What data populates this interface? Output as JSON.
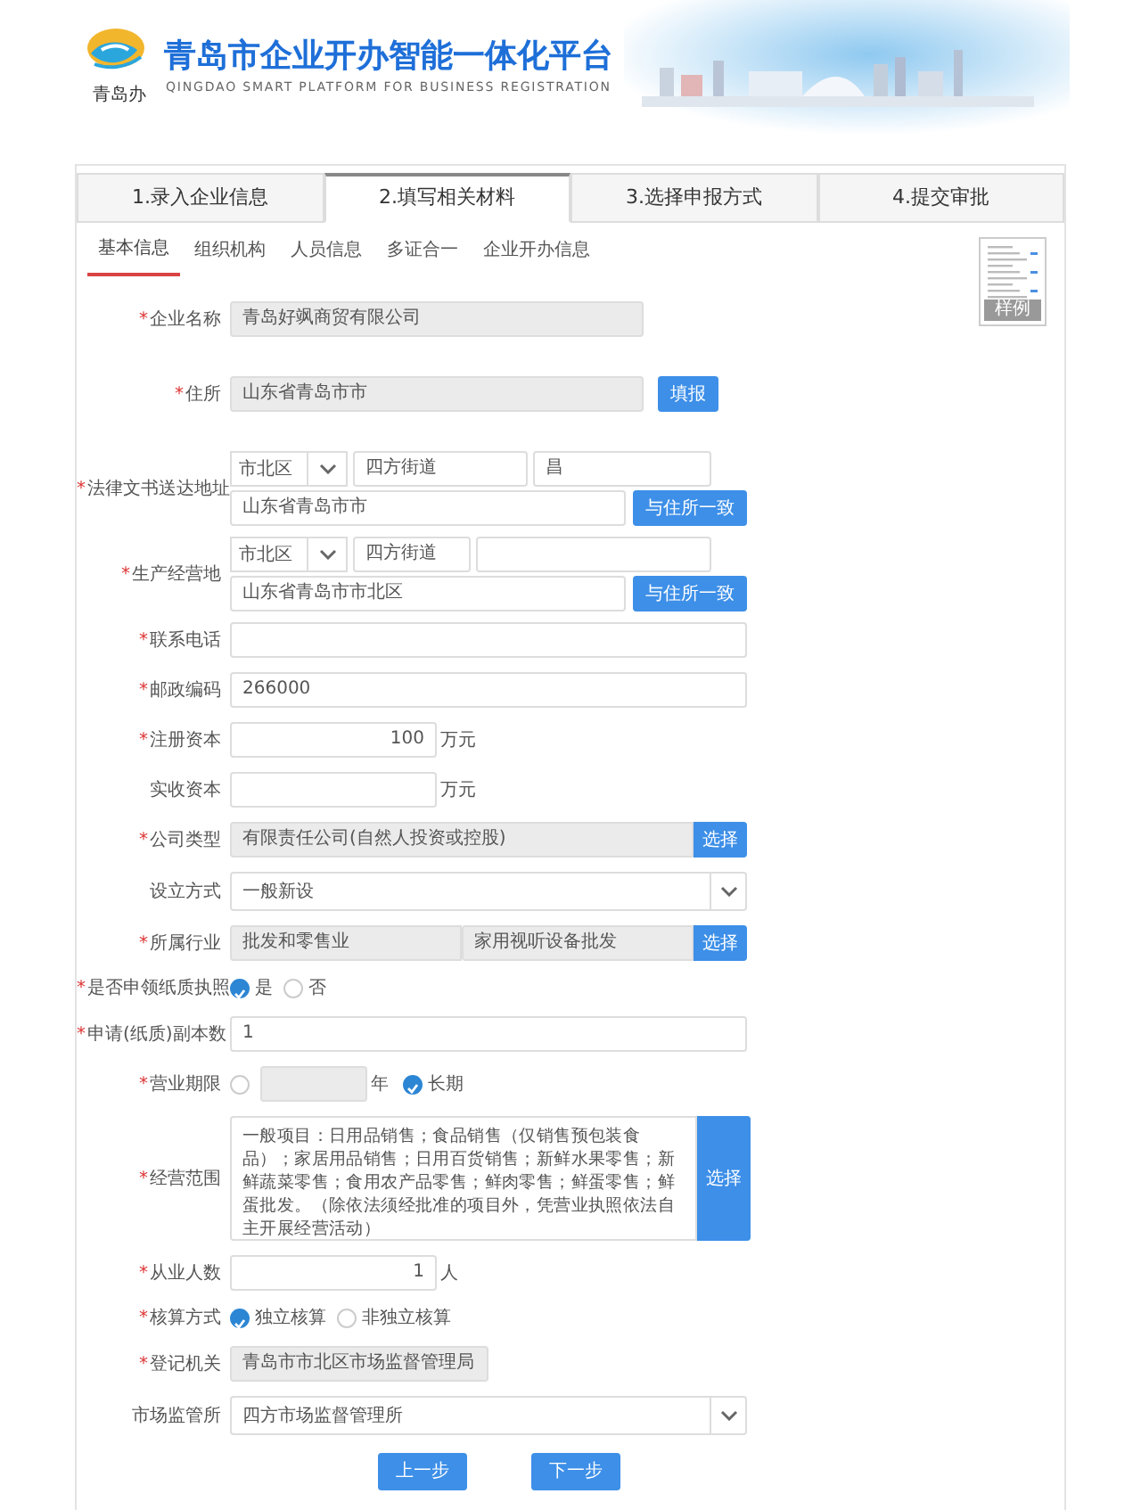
{
  "header": {
    "title": "青岛市企业开办智能一体化平台",
    "subtitle": "QINGDAO SMART PLATFORM FOR BUSINESS REGISTRATION",
    "logo_caption": "青岛办"
  },
  "steps": [
    {
      "label": "1.录入企业信息",
      "selected": false
    },
    {
      "label": "2.填写相关材料",
      "selected": true
    },
    {
      "label": "3.选择申报方式",
      "selected": false
    },
    {
      "label": "4.提交审批",
      "selected": false
    }
  ],
  "subtabs": [
    {
      "label": "基本信息",
      "selected": true
    },
    {
      "label": "组织机构",
      "selected": false
    },
    {
      "label": "人员信息",
      "selected": false
    },
    {
      "label": "多证合一",
      "selected": false
    },
    {
      "label": "企业开办信息",
      "selected": false
    }
  ],
  "sample": {
    "label": "样例"
  },
  "fields": [
    {
      "kind": "text",
      "label": "企业名称",
      "marker": "*",
      "value": "青岛好飒商贸有限公司",
      "readonly": true
    },
    {
      "kind": "text-button",
      "label": "住所",
      "marker": "*",
      "value": "山东省青岛市市",
      "readonly": true,
      "button": "填报"
    },
    {
      "kind": "address",
      "label": "法律文书送达地址",
      "marker": "*",
      "district": "市北区",
      "street": "四方街道",
      "community": "昌",
      "detail": "山东省青岛市市",
      "button": "与住所一致"
    },
    {
      "kind": "address",
      "label": "生产经营地",
      "marker": "*",
      "district": "市北区",
      "street": "四方街道",
      "detail": "山东省青岛市市北区",
      "button": "与住所一致"
    },
    {
      "kind": "text",
      "label": "联系电话",
      "marker": "*",
      "readonly": false
    },
    {
      "kind": "text",
      "label": "邮政编码",
      "marker": "*",
      "value": "266000",
      "readonly": false
    },
    {
      "kind": "money",
      "label": "注册资本",
      "marker": "*",
      "value": "100",
      "unit": "万元"
    },
    {
      "kind": "money",
      "label": "实收资本",
      "unit": "万元"
    },
    {
      "kind": "text-button",
      "label": "公司类型",
      "marker": "*",
      "value": "有限责任公司(自然人投资或控股)",
      "readonly": true,
      "button": "选择"
    },
    {
      "kind": "select",
      "label": "设立方式",
      "value": "一般新设"
    },
    {
      "kind": "dual-button",
      "label": "所属行业",
      "marker": "*",
      "values": [
        "批发和零售业",
        "家用视听设备批发"
      ],
      "button": "选择"
    },
    {
      "kind": "radio",
      "label": "是否申领纸质执照",
      "marker": "*",
      "options": [
        {
          "label": "是",
          "selected": true
        },
        {
          "label": "否",
          "selected": false
        }
      ]
    },
    {
      "kind": "text",
      "label": "申请(纸质)副本数",
      "marker": "*",
      "value": "1",
      "readonly": false
    },
    {
      "kind": "period",
      "label": "营业期限",
      "marker": "*",
      "fixed": {
        "selected": false,
        "unit": "年"
      },
      "long": {
        "label": "长期",
        "selected": true
      }
    },
    {
      "kind": "textarea-button",
      "label": "经营范围",
      "marker": "*",
      "value": "一般项目：日用品销售；食品销售（仅销售预包装食品）；家居用品销售；日用百货销售；新鲜水果零售；新鲜蔬菜零售；食用农产品零售；鲜肉零售；鲜蛋零售；鲜蛋批发。（除依法须经批准的项目外，凭营业执照依法自主开展经营活动）",
      "button": "选择"
    },
    {
      "kind": "money",
      "label": "从业人数",
      "marker": "*",
      "value": "1",
      "unit": "人"
    },
    {
      "kind": "radio",
      "label": "核算方式",
      "marker": "*",
      "options": [
        {
          "label": "独立核算",
          "selected": true
        },
        {
          "label": "非独立核算",
          "selected": false
        }
      ]
    },
    {
      "kind": "short",
      "label": "登记机关",
      "marker": "*",
      "value": "青岛市市北区市场监督管理局",
      "readonly": true
    },
    {
      "kind": "select",
      "label": "市场监管所",
      "value": "四方市场监督管理所"
    }
  ],
  "actions": [
    "上一步",
    "下一步"
  ]
}
